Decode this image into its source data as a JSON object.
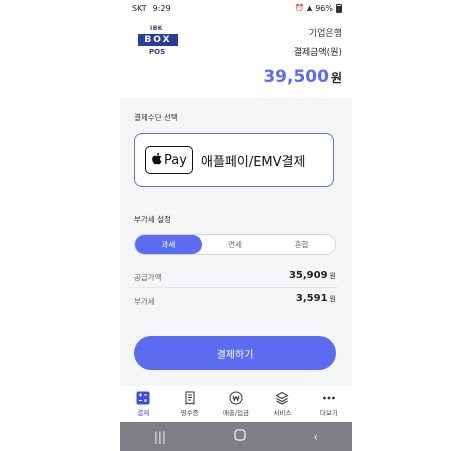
{
  "status_bar": {
    "carrier": "SKT",
    "time": "9:29",
    "battery": "96%"
  },
  "header": {
    "logo": {
      "top": "IBK",
      "middle": "BOX",
      "bottom": "POS"
    },
    "bank_name": "기업은행",
    "amount_label": "결제금액(원)",
    "amount_value": "39,500",
    "amount_unit": "원"
  },
  "payment_method": {
    "section_title": "결제수단 선택",
    "apple_pay_text": "Pay",
    "label": "애플페이/EMV결제"
  },
  "tax": {
    "section_title": "부가세 설정",
    "options": [
      "과세",
      "면세",
      "혼합"
    ],
    "selected": "과세"
  },
  "summary": {
    "supply_label": "공급가액",
    "supply_value": "35,909",
    "vat_label": "부가세",
    "vat_value": "3,591",
    "unit": "원"
  },
  "pay_button": "결제하기",
  "tabs": [
    {
      "label": "결제",
      "icon": "calculator-icon",
      "active": true
    },
    {
      "label": "영수증",
      "icon": "receipt-icon"
    },
    {
      "label": "매출/입금",
      "icon": "won-coin-icon"
    },
    {
      "label": "서비스",
      "icon": "layers-icon"
    },
    {
      "label": "더보기",
      "icon": "more-icon"
    }
  ],
  "colors": {
    "accent": "#5b6cf0",
    "brand": "#2c3e91",
    "nav": "#7d7f84"
  }
}
